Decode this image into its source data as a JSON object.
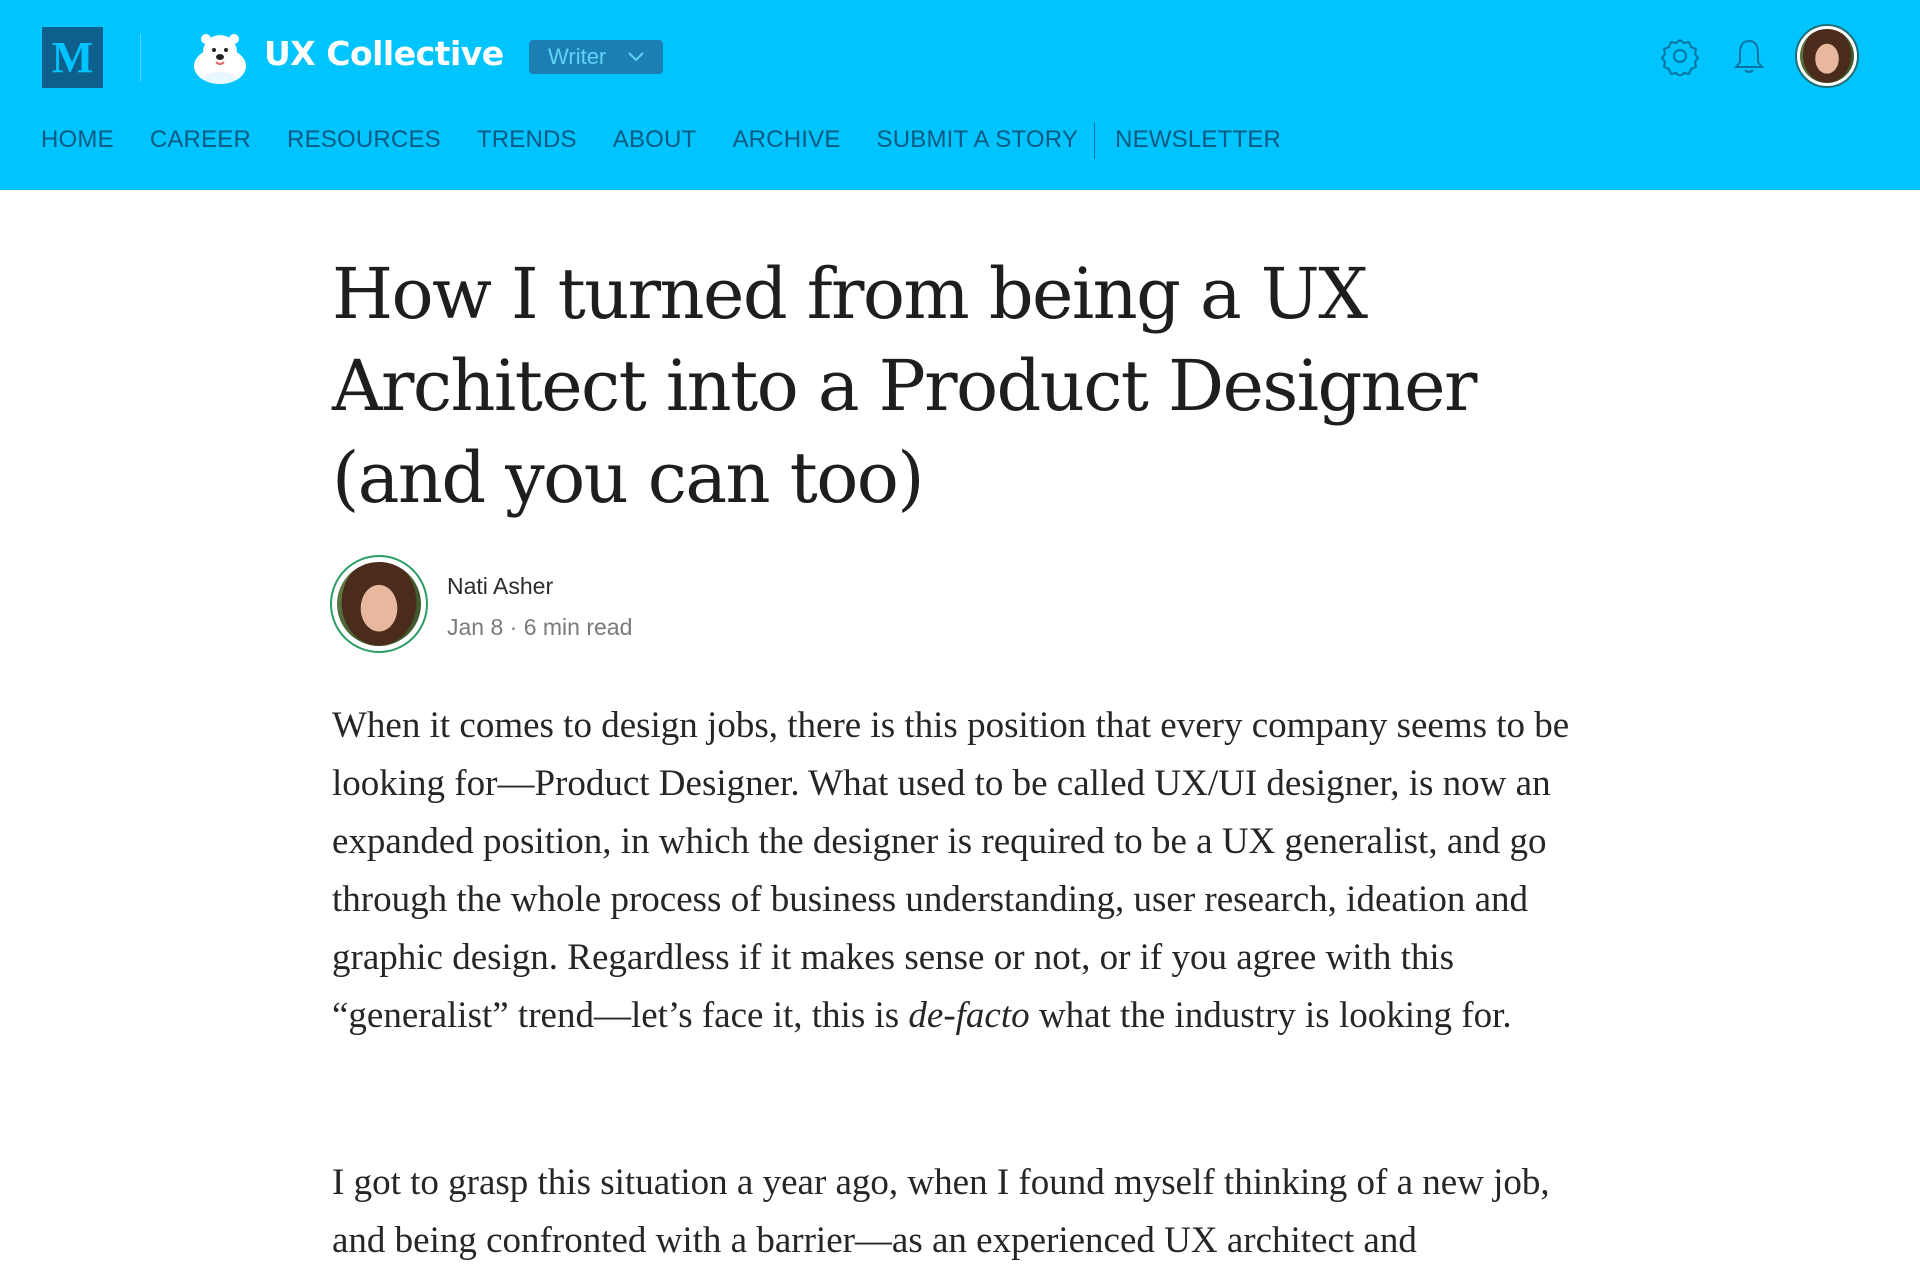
{
  "header": {
    "logo_letter": "M",
    "publication_name": "UX Collective",
    "writer_label": "Writer",
    "icons": [
      "settings-gear-icon",
      "notification-bell-icon",
      "chevron-down-icon",
      "polar-bear-mascot"
    ],
    "colors": {
      "header_bg": "#00c4ff",
      "nav_text": "#0b5a82",
      "logo_bg": "#0d5f8c"
    }
  },
  "nav": {
    "items": [
      "HOME",
      "CAREER",
      "RESOURCES",
      "TRENDS",
      "ABOUT",
      "ARCHIVE",
      "SUBMIT A STORY",
      "NEWSLETTER"
    ]
  },
  "article": {
    "title": "How I turned from being a UX Architect into a Product Designer (and you can too)",
    "author": "Nati Asher",
    "date": "Jan 8",
    "separator": "·",
    "read_time": "6 min read",
    "p1_before_italic": "When it comes to design jobs, there is this position that every company seems to be looking for—Product Designer. What used to be called UX/UI designer, is now an expanded position, in which the designer is required to be a UX generalist, and go through the whole process of business understanding, user research, ideation and graphic design. Regardless if it makes sense or not, or if you agree with this “generalist” trend—let’s face it, this is ",
    "p1_italic": "de-facto",
    "p1_after_italic": " what the industry is looking for.",
    "p2": "I got to grasp this situation a year ago, when I found myself thinking of a new job, and being confronted with a barrier—as an experienced UX architect and"
  }
}
